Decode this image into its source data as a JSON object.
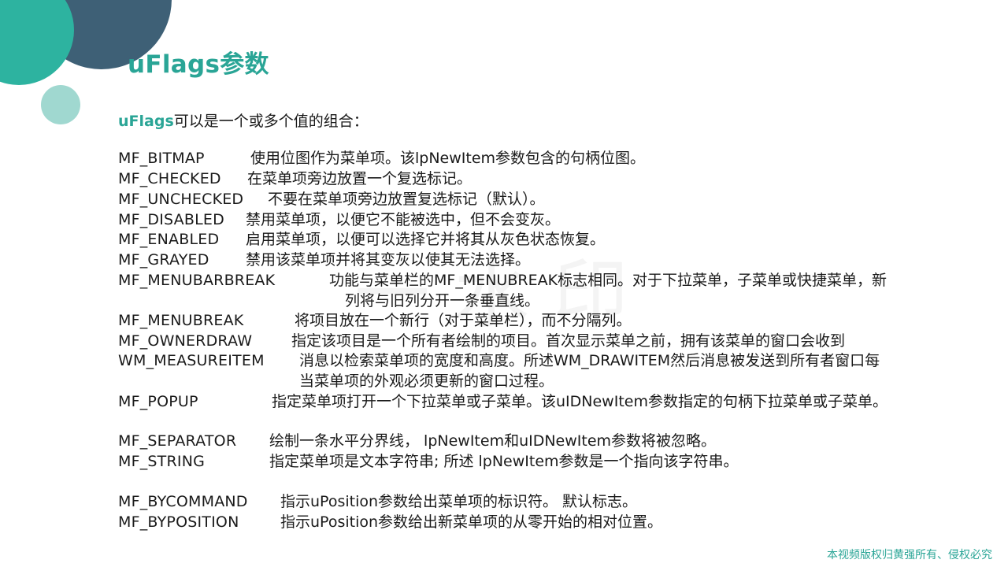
{
  "slide": {
    "title": "uFlags参数",
    "intro_keyword": "uFlags",
    "intro_rest": "可以是一个或多个值的组合：",
    "watermark": "一水印",
    "copyright": "本视频版权归黄强所有、侵权必究"
  },
  "flags": [
    {
      "name": "MF_BITMAP",
      "desc": "使用位图作为菜单项。该lpNewItem参数包含的句柄位图。"
    },
    {
      "name": "MF_CHECKED",
      "desc": "在菜单项旁边放置一个复选标记。"
    },
    {
      "name": "MF_UNCHECKED",
      "desc": "不要在菜单项旁边放置复选标记（默认）。"
    },
    {
      "name": "MF_DISABLED",
      "desc": "禁用菜单项，以便它不能被选中，但不会变灰。"
    },
    {
      "name": "MF_ENABLED",
      "desc": "启用菜单项，以便可以选择它并将其从灰色状态恢复。"
    },
    {
      "name": "MF_GRAYED",
      "desc": "禁用该菜单项并将其变灰以使其无法选择。"
    },
    {
      "name": "MF_MENUBARBREAK",
      "desc": "功能与菜单栏的MF_MENUBREAK标志相同。对于下拉菜单，子菜单或快捷菜单，新",
      "cont": "列将与旧列分开一条垂直线。"
    },
    {
      "name": "MF_MENUBREAK",
      "desc": "将项目放在一个新行（对于菜单栏），而不分隔列。"
    },
    {
      "name": "MF_OWNERDRAW",
      "desc": "指定该项目是一个所有者绘制的项目。首次显示菜单之前，拥有该菜单的窗口会收到"
    },
    {
      "name": "WM_MEASUREITEM",
      "desc": "消息以检索菜单项的宽度和高度。所述WM_DRAWITEM然后消息被发送到所有者窗口每",
      "cont": "当菜单项的外观必须更新的窗口过程。"
    },
    {
      "name": "MF_POPUP",
      "desc": "指定菜单项打开一个下拉菜单或子菜单。该uIDNewItem参数指定的句柄下拉菜单或子菜单。"
    },
    {
      "name": "MF_SEPARATOR",
      "desc": "绘制一条水平分界线， lpNewItem和uIDNewItem参数将被忽略。"
    },
    {
      "name": "MF_STRING",
      "desc": "指定菜单项是文本字符串; 所述 lpNewItem参数是一个指向该字符串。"
    },
    {
      "name": "MF_BYCOMMAND",
      "desc": "指示uPosition参数给出菜单项的标识符。 默认标志。"
    },
    {
      "name": "MF_BYPOSITION",
      "desc": "指示uPosition参数给出新菜单项的从零开始的相对位置。"
    }
  ]
}
